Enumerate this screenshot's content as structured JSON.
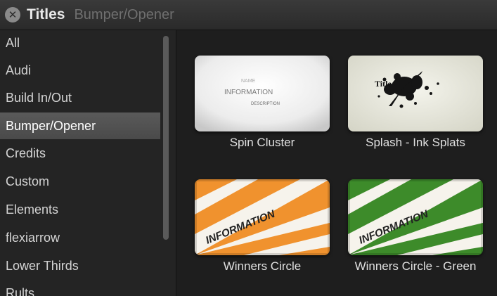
{
  "header": {
    "title": "Titles",
    "subtitle": "Bumper/Opener"
  },
  "sidebar": {
    "items": [
      {
        "label": "All"
      },
      {
        "label": "Audi"
      },
      {
        "label": "Build In/Out"
      },
      {
        "label": "Bumper/Opener",
        "selected": true
      },
      {
        "label": "Credits"
      },
      {
        "label": "Custom"
      },
      {
        "label": "Elements"
      },
      {
        "label": "flexiarrow"
      },
      {
        "label": "Lower Thirds"
      },
      {
        "label": "Rults"
      }
    ]
  },
  "tiles": [
    {
      "label": "Spin Cluster",
      "thumb_lines": [
        "NAME",
        "INFORMATION",
        "DESCRIPTION"
      ]
    },
    {
      "label": "Splash - Ink Splats",
      "thumb_text": "Title"
    },
    {
      "label": "Winners Circle",
      "thumb_text": "INFORMATION",
      "accent": "#f0922e"
    },
    {
      "label": "Winners Circle - Green",
      "thumb_text": "INFORMATION",
      "accent": "#3d8b2a"
    }
  ]
}
